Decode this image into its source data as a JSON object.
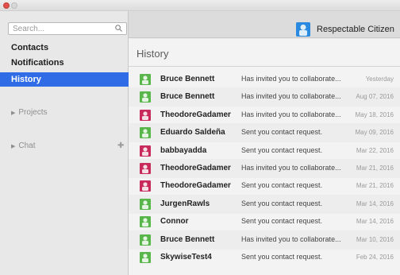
{
  "window": {
    "controls": [
      "close",
      "minimize"
    ]
  },
  "search": {
    "placeholder": "Search...",
    "icon": "search-icon"
  },
  "nav": {
    "contacts": "Contacts",
    "notifications": "Notifications",
    "history": "History",
    "projects": "Projects",
    "chat": "Chat",
    "chat_add_icon": "plus-icon"
  },
  "profile": {
    "name": "Respectable Citizen",
    "avatar_color": "#2a8ae0"
  },
  "main": {
    "title": "History",
    "rows": [
      {
        "name": "Bruce Bennett",
        "message": "Has invited you to collaborate...",
        "date": "Yesterday",
        "avatar_color": "#58b64a"
      },
      {
        "name": "Bruce Bennett",
        "message": "Has invited you to collaborate...",
        "date": "Aug 07, 2016",
        "avatar_color": "#58b64a"
      },
      {
        "name": "TheodoreGadamer",
        "message": "Has invited you to collaborate...",
        "date": "May 18, 2016",
        "avatar_color": "#c82a5b"
      },
      {
        "name": "Eduardo Saldeña",
        "message": "Sent you contact request.",
        "date": "May 09, 2016",
        "avatar_color": "#58b64a"
      },
      {
        "name": "babbayadda",
        "message": "Sent you contact request.",
        "date": "Mar 22, 2016",
        "avatar_color": "#c82a5b"
      },
      {
        "name": "TheodoreGadamer",
        "message": "Has invited you to collaborate...",
        "date": "Mar 21, 2016",
        "avatar_color": "#c82a5b"
      },
      {
        "name": "TheodoreGadamer",
        "message": "Sent you contact request.",
        "date": "Mar 21, 2016",
        "avatar_color": "#c82a5b"
      },
      {
        "name": "JurgenRawls",
        "message": "Sent you contact request.",
        "date": "Mar 14, 2016",
        "avatar_color": "#58b64a"
      },
      {
        "name": "Connor",
        "message": "Sent you contact request.",
        "date": "Mar 14, 2016",
        "avatar_color": "#58b64a"
      },
      {
        "name": "Bruce Bennett",
        "message": "Has invited you to collaborate...",
        "date": "Mar 10, 2016",
        "avatar_color": "#58b64a"
      },
      {
        "name": "SkywiseTest4",
        "message": "Sent you contact request.",
        "date": "Feb 24, 2016",
        "avatar_color": "#58b64a"
      }
    ]
  },
  "colors": {
    "active_nav": "#2f6ce6",
    "content_bg": "#f3f3f3",
    "sidebar_bg": "#e8e8e8"
  }
}
